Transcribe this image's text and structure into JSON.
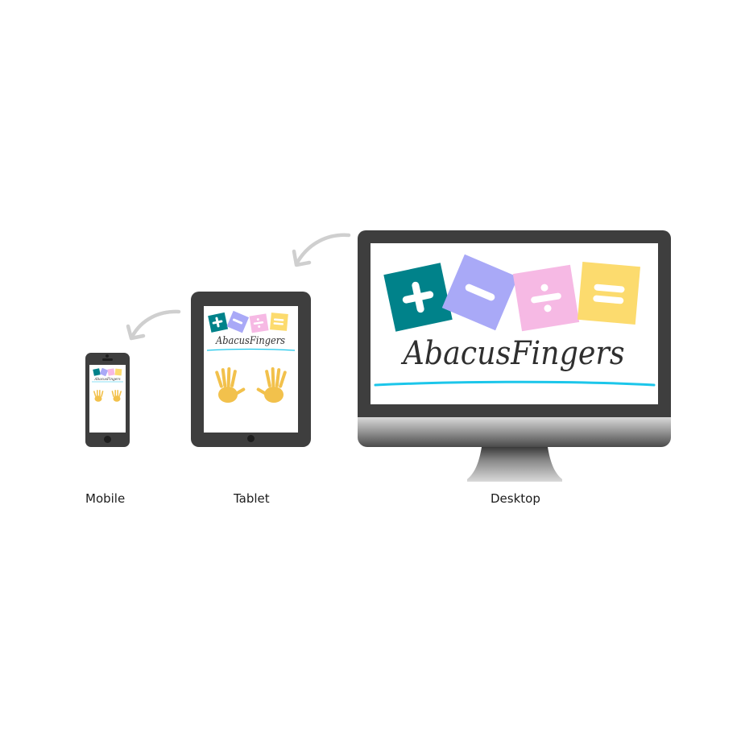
{
  "devices": [
    {
      "id": "mobile",
      "label": "Mobile"
    },
    {
      "id": "tablet",
      "label": "Tablet"
    },
    {
      "id": "desktop",
      "label": "Desktop"
    }
  ],
  "brand": {
    "name": "AbacusFingers",
    "symbols": [
      "+",
      "−",
      "÷",
      "="
    ],
    "tile_colors": [
      "#00828a",
      "#a9a9f7",
      "#f6b9e4",
      "#fcdb6e"
    ],
    "underline_color": "#1cc6ea",
    "hand_color": "#f2c14c"
  },
  "icons": {
    "arrow": "curved-arrow-left-icon",
    "hands": "hand-print-icon"
  }
}
